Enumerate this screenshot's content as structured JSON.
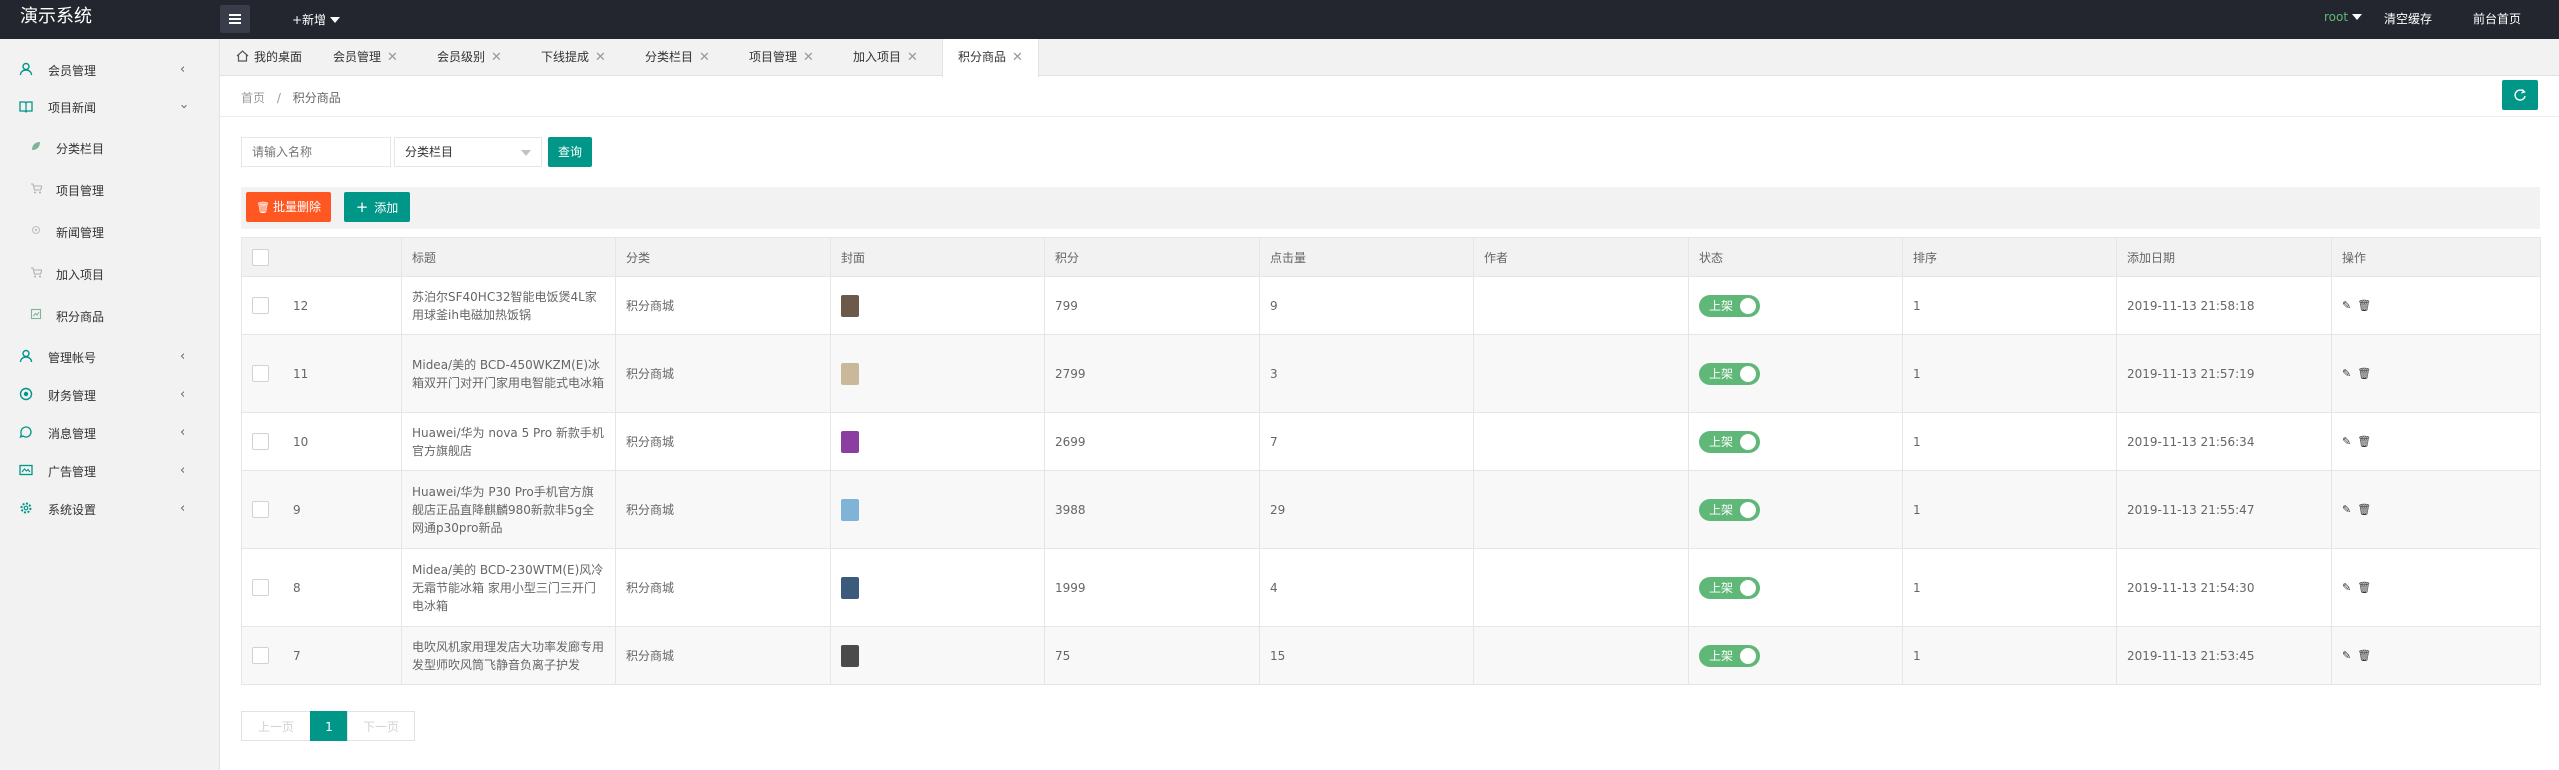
{
  "app": {
    "title": "演示系统"
  },
  "topbar": {
    "add_new": "+新增",
    "user": "root",
    "clear_cache": "清空缓存",
    "front_home": "前台首页"
  },
  "sidebar": {
    "items": [
      {
        "label": "会员管理",
        "icon": "user-icon"
      },
      {
        "label": "项目新闻",
        "icon": "book-icon",
        "expanded": true
      },
      {
        "label": "管理帐号",
        "icon": "account-icon"
      },
      {
        "label": "财务管理",
        "icon": "finance-icon"
      },
      {
        "label": "消息管理",
        "icon": "message-icon"
      },
      {
        "label": "广告管理",
        "icon": "ad-icon"
      },
      {
        "label": "系统设置",
        "icon": "gear-icon"
      }
    ],
    "sub_items": [
      {
        "label": "分类栏目",
        "icon": "leaf-icon"
      },
      {
        "label": "项目管理",
        "icon": "cart-icon"
      },
      {
        "label": "新闻管理",
        "icon": "news-icon"
      },
      {
        "label": "加入项目",
        "icon": "cart-icon"
      },
      {
        "label": "积分商品",
        "icon": "gift-icon"
      }
    ]
  },
  "tabs": [
    {
      "label": "我的桌面",
      "closable": false
    },
    {
      "label": "会员管理",
      "closable": true
    },
    {
      "label": "会员级别",
      "closable": true
    },
    {
      "label": "下线提成",
      "closable": true
    },
    {
      "label": "分类栏目",
      "closable": true
    },
    {
      "label": "项目管理",
      "closable": true
    },
    {
      "label": "加入项目",
      "closable": true
    },
    {
      "label": "积分商品",
      "closable": true,
      "active": true
    }
  ],
  "breadcrumb": {
    "home": "首页",
    "sep": "/",
    "current": "积分商品"
  },
  "search": {
    "placeholder": "请输入名称",
    "category_value": "分类栏目",
    "query_label": "查询"
  },
  "actions": {
    "batch_delete": "批量删除",
    "add": "添加"
  },
  "table": {
    "columns": [
      "",
      "标题",
      "分类",
      "封面",
      "积分",
      "点击量",
      "作者",
      "状态",
      "排序",
      "添加日期",
      "操作"
    ],
    "rows": [
      {
        "id": "12",
        "title": "苏泊尔SF40HC32智能电饭煲4L家用球釜ih电磁加热饭锅",
        "category": "积分商城",
        "cover_color": "#6b5a4a",
        "points": "799",
        "clicks": "9",
        "author": "",
        "status": "上架",
        "sort": "1",
        "date": "2019-11-13 21:58:18"
      },
      {
        "id": "11",
        "title": "Midea/美的 BCD-450WKZM(E)冰箱双开门对开门家用电智能式电冰箱",
        "category": "积分商城",
        "cover_color": "#c9b89a",
        "points": "2799",
        "clicks": "3",
        "author": "",
        "status": "上架",
        "sort": "1",
        "date": "2019-11-13 21:57:19"
      },
      {
        "id": "10",
        "title": "Huawei/华为 nova 5 Pro 新款手机官方旗舰店",
        "category": "积分商城",
        "cover_color": "#8a3fa0",
        "points": "2699",
        "clicks": "7",
        "author": "",
        "status": "上架",
        "sort": "1",
        "date": "2019-11-13 21:56:34"
      },
      {
        "id": "9",
        "title": "Huawei/华为 P30 Pro手机官方旗舰店正品直降麒麟980新款非5g全网通p30pro新品",
        "category": "积分商城",
        "cover_color": "#7fb4d8",
        "points": "3988",
        "clicks": "29",
        "author": "",
        "status": "上架",
        "sort": "1",
        "date": "2019-11-13 21:55:47"
      },
      {
        "id": "8",
        "title": "Midea/美的 BCD-230WTM(E)风冷无霜节能冰箱 家用小型三门三开门电冰箱",
        "category": "积分商城",
        "cover_color": "#3c5a7a",
        "points": "1999",
        "clicks": "4",
        "author": "",
        "status": "上架",
        "sort": "1",
        "date": "2019-11-13 21:54:30"
      },
      {
        "id": "7",
        "title": "电吹风机家用理发店大功率发廊专用发型师吹风筒飞静音负离子护发",
        "category": "积分商城",
        "cover_color": "#4a4a4a",
        "points": "75",
        "clicks": "15",
        "author": "",
        "status": "上架",
        "sort": "1",
        "date": "2019-11-13 21:53:45"
      }
    ]
  },
  "pager": {
    "prev": "上一页",
    "current": "1",
    "next": "下一页"
  },
  "colors": {
    "primary": "#009688",
    "danger": "#ff5722",
    "switch_on": "#5fb878",
    "topbar": "#23262e"
  }
}
